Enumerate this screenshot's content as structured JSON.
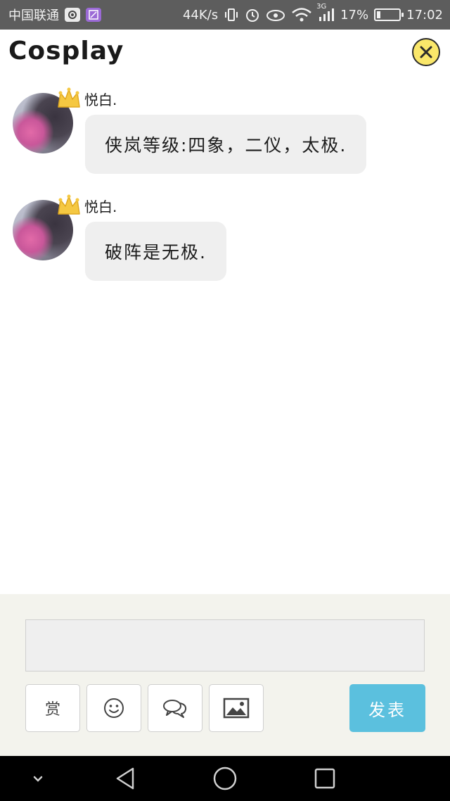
{
  "status_bar": {
    "carrier": "中国联通",
    "network_speed": "44K/s",
    "signal_type": "3G",
    "battery_percent": "17%",
    "battery_level": 0.17,
    "time": "17:02",
    "icons": [
      "camera-app-icon",
      "gallery-app-icon",
      "vibrate-icon",
      "alarm-icon",
      "eye-icon",
      "wifi-icon",
      "signal-icon",
      "battery-icon"
    ]
  },
  "header": {
    "title": "Cosplay",
    "close_icon": "close-icon",
    "accent_color": "#fae76a"
  },
  "messages": [
    {
      "sender": "悦白.",
      "text": "侠岚等级:四象，二仪，太极."
    },
    {
      "sender": "悦白.",
      "text": "破阵是无极."
    }
  ],
  "composer": {
    "input_value": "",
    "tools": [
      {
        "name": "reward",
        "label": "赏"
      },
      {
        "name": "emoji",
        "icon": "smiley-icon"
      },
      {
        "name": "chat",
        "icon": "chat-bubbles-icon"
      },
      {
        "name": "image",
        "icon": "image-icon"
      }
    ],
    "send_label": "发表",
    "send_color": "#5bc0de"
  },
  "nav_bar": {
    "icons": [
      "chevron-down-icon",
      "back-icon",
      "home-icon",
      "recents-icon"
    ]
  }
}
